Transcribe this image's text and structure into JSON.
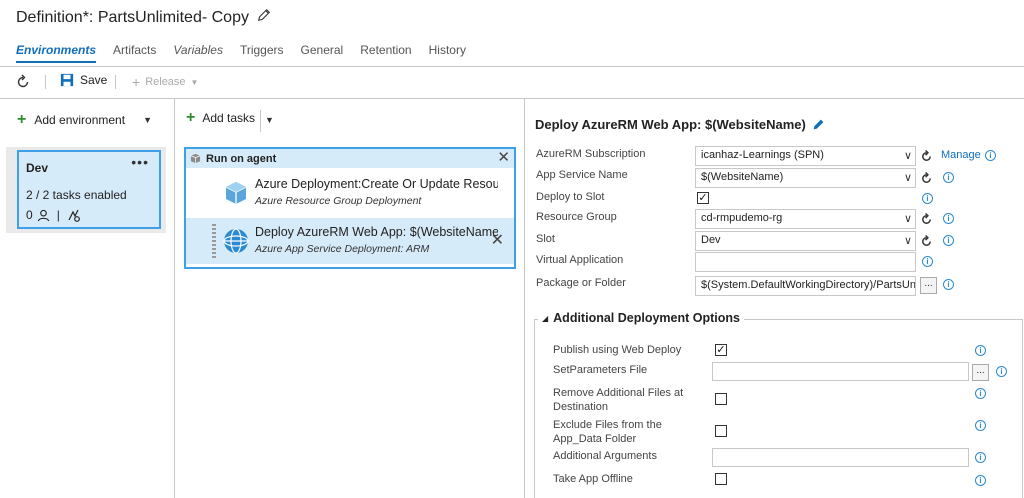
{
  "header": {
    "title": "Definition*: PartsUnlimited- Copy"
  },
  "tabs": [
    {
      "label": "Environments"
    },
    {
      "label": "Artifacts"
    },
    {
      "label": "Variables"
    },
    {
      "label": "Triggers"
    },
    {
      "label": "General"
    },
    {
      "label": "Retention"
    },
    {
      "label": "History"
    }
  ],
  "toolbar": {
    "save_label": "Save",
    "release_label": "Release"
  },
  "environments": {
    "add_label": "Add environment",
    "card": {
      "name": "Dev",
      "tasks_enabled": "2 / 2 tasks enabled",
      "approvers_count": "0"
    }
  },
  "tasks_panel": {
    "add_label": "Add tasks",
    "phase_label": "Run on agent",
    "tasks": [
      {
        "title": "Azure Deployment:Create Or Update Resour",
        "subtitle": "Azure Resource Group Deployment"
      },
      {
        "title": "Deploy AzureRM Web App: $(WebsiteName",
        "subtitle": "Azure App Service Deployment: ARM"
      }
    ]
  },
  "detail": {
    "title": "Deploy AzureRM Web App: $(WebsiteName)",
    "manage_label": "Manage",
    "fields": {
      "subscription_label": "AzureRM Subscription",
      "subscription_value": "icanhaz-Learnings (SPN)",
      "app_service_label": "App Service Name",
      "app_service_value": "$(WebsiteName)",
      "deploy_slot_label": "Deploy to Slot",
      "resource_group_label": "Resource Group",
      "resource_group_value": "cd-rmpudemo-rg",
      "slot_label": "Slot",
      "slot_value": "Dev",
      "virtual_app_label": "Virtual Application",
      "virtual_app_value": "",
      "package_label": "Package or Folder",
      "package_value": "$(System.DefaultWorkingDirectory)/PartsUnlim",
      "browse_label": "..."
    },
    "advanced": {
      "title": "Additional Deployment Options",
      "publish_label": "Publish using Web Deploy",
      "setparams_label": "SetParameters File",
      "remove_files_label": "Remove Additional Files at Destination",
      "exclude_label": "Exclude Files from the App_Data Folder",
      "args_label": "Additional Arguments",
      "offline_label": "Take App Offline",
      "browse_label": "..."
    },
    "checkboxes": {
      "deploy_to_slot": true,
      "publish_web_deploy": true,
      "remove_additional": false,
      "exclude_app_data": false,
      "take_offline": false
    }
  },
  "colors": {
    "accent": "#106ebe",
    "selected_bg": "#d6ebfa",
    "selected_border": "#3ea0e6",
    "add_green": "#2e8b2e"
  }
}
